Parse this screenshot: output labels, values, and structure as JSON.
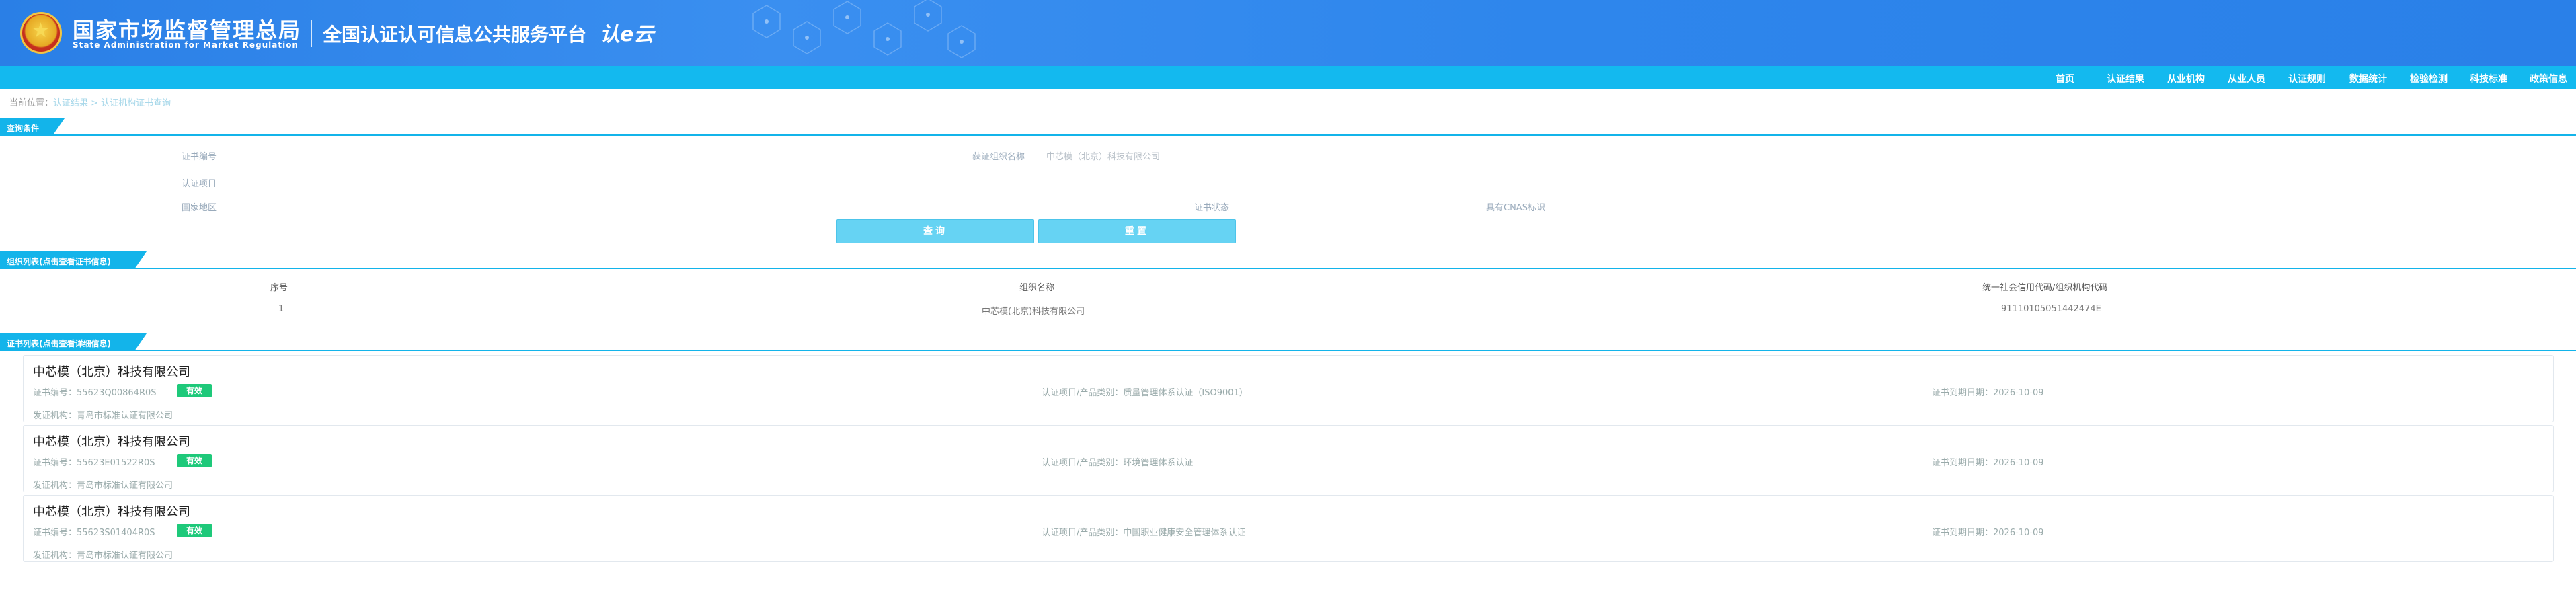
{
  "header": {
    "org_cn": "国家市场监督管理总局",
    "org_en": "State Administration  for  Market Regulation",
    "platform": "全国认证认可信息公共服务平台",
    "logo_text": "认e云"
  },
  "nav": {
    "items": [
      "首页",
      "认证结果",
      "从业机构",
      "从业人员",
      "认证规则",
      "数据统计",
      "检验检测",
      "科技标准",
      "政策信息"
    ]
  },
  "breadcrumb": {
    "prefix": "当前位置：",
    "path": "认证结果 > 认证机构证书查询"
  },
  "query": {
    "section_title": "查询条件",
    "cert_no_label": "证书编号",
    "org_name_label": "获证组织名称",
    "org_name_value": "中芯模（北京）科技有限公司",
    "project_label": "认证项目",
    "region_label": "国家地区",
    "status_label": "证书状态",
    "cnas_label": "具有CNAS标识",
    "search_button": "查询",
    "reset_button": "重置"
  },
  "org_list": {
    "section_title": "组织列表(点击查看证书信息)",
    "headers": [
      "序号",
      "组织名称",
      "统一社会信用代码/组织机构代码"
    ],
    "rows": [
      {
        "index": "1",
        "name": "中芯模(北京)科技有限公司",
        "code": "91110105051442474E"
      }
    ]
  },
  "cert_list": {
    "section_title": "证书列表(点击查看详细信息)",
    "cards": [
      {
        "org": "中芯模（北京）科技有限公司",
        "cert_no": "证书编号：55623Q00864R0S",
        "status": "有效",
        "project": "认证项目/产品类别：质量管理体系认证（ISO9001）",
        "expire": "证书到期日期：2026-10-09",
        "issuer": "发证机构：青岛市标准认证有限公司"
      },
      {
        "org": "中芯模（北京）科技有限公司",
        "cert_no": "证书编号：55623E01522R0S",
        "status": "有效",
        "project": "认证项目/产品类别：环境管理体系认证",
        "expire": "证书到期日期：2026-10-09",
        "issuer": "发证机构：青岛市标准认证有限公司"
      },
      {
        "org": "中芯模（北京）科技有限公司",
        "cert_no": "证书编号：55623S01404R0S",
        "status": "有效",
        "project": "认证项目/产品类别：中国职业健康安全管理体系认证",
        "expire": "证书到期日期：2026-10-09",
        "issuer": "发证机构：青岛市标准认证有限公司"
      }
    ]
  },
  "colors": {
    "header_blue": "#2a80e8",
    "nav_cyan": "#13b9ef",
    "button": "#66d3f3",
    "status_green": "#1ec97a"
  }
}
